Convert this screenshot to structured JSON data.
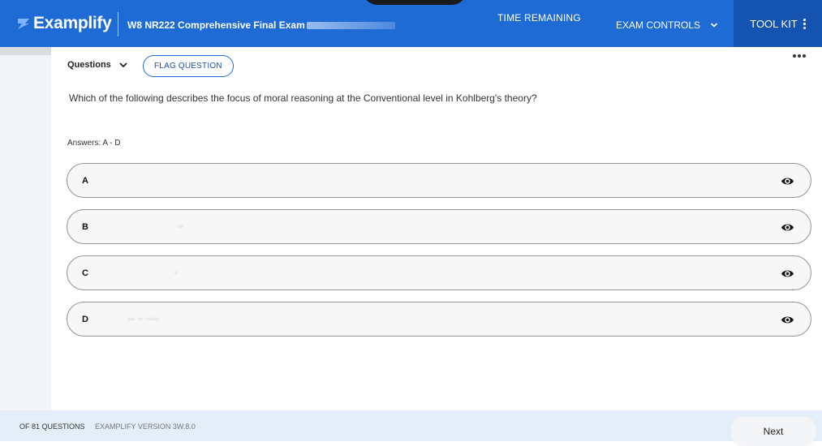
{
  "header": {
    "brand": "Examplify",
    "exam_title": "W8 NR222 Comprehensive Final Exam",
    "time_label": "TIME REMAINING",
    "exam_controls_label": "EXAM CONTROLS",
    "toolkit_label": "TOOL KIT",
    "brand_color": "#1e6bd6"
  },
  "question_header": {
    "selector_label": "Questions",
    "flag_label": "FLAG QUESTION"
  },
  "question": {
    "text": "Which of the following describes the focus of moral reasoning at the Conventional level in Kohlberg's theory?",
    "answers_label": "Answers: A - D"
  },
  "options": [
    {
      "letter": "A",
      "text": ""
    },
    {
      "letter": "B",
      "text": "··"
    },
    {
      "letter": "C",
      "text": "·"
    },
    {
      "letter": "D",
      "text": "···  ·· ·····"
    }
  ],
  "footer": {
    "question_count": "OF 81 QUESTIONS",
    "version": "EXAMPLIFY VERSION 3W.8.0",
    "next_label": "Next"
  },
  "icons": {
    "logo": "examplify-logo-icon",
    "chevron": "chevron-down-icon",
    "kebab": "kebab-menu-icon",
    "more": "more-horizontal-icon",
    "eye": "eye-icon"
  }
}
